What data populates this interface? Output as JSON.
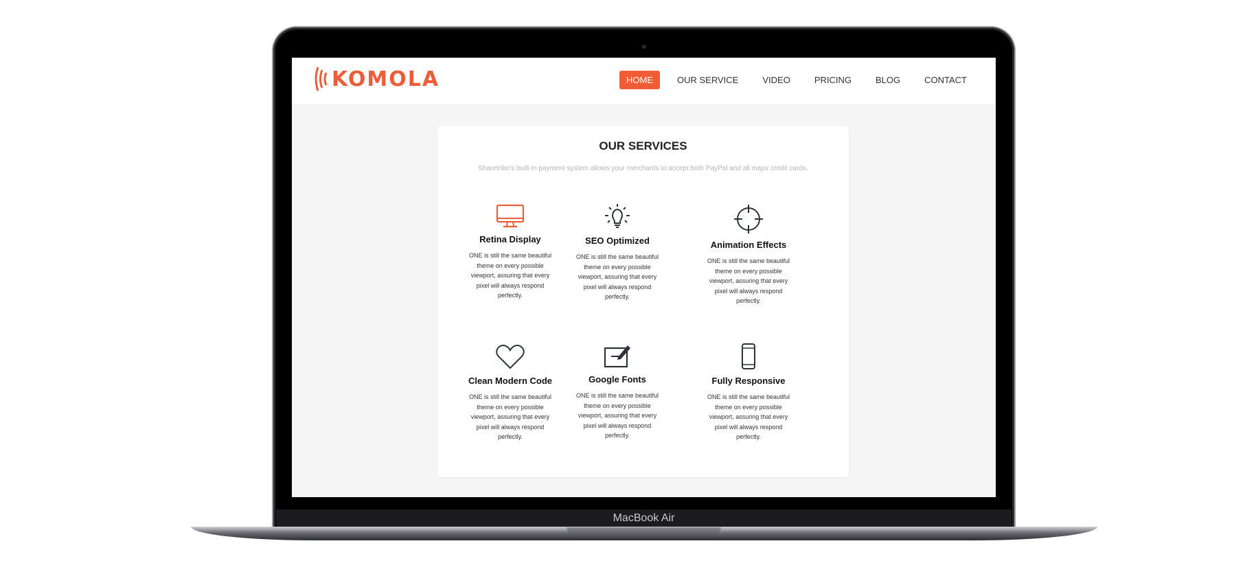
{
  "device": {
    "label": "MacBook Air"
  },
  "header": {
    "logo_text": "KOMOLA",
    "menu": [
      {
        "label": "HOME",
        "active": true
      },
      {
        "label": "OUR SERVICE",
        "active": false
      },
      {
        "label": "VIDEO",
        "active": false
      },
      {
        "label": "PRICING",
        "active": false
      },
      {
        "label": "BLOG",
        "active": false
      },
      {
        "label": "CONTACT",
        "active": false
      }
    ]
  },
  "services": {
    "title": "OUR SERVICES",
    "subtitle": "Sharetribe's built-in payment system allows your merchants to accept both PayPal and all major credit cards.",
    "items": [
      {
        "icon": "monitor-icon",
        "title": "Retina Display",
        "desc": "ONE is still the same beautiful theme on every possible viewport, assuring that every pixel will always respond perfectly."
      },
      {
        "icon": "lightbulb-icon",
        "title": "SEO Optimized",
        "desc": "ONE is still the same beautiful theme on every possible viewport, assuring that every pixel will always respond perfectly."
      },
      {
        "icon": "crosshair-icon",
        "title": "Animation Effects",
        "desc": "ONE is still the same beautiful theme on every possible viewport, assuring that every pixel will always respond perfectly."
      },
      {
        "icon": "heart-icon",
        "title": "Clean Modern Code",
        "desc": "ONE is still the same beautiful theme on every possible viewport, assuring that every pixel will always respond perfectly."
      },
      {
        "icon": "edit-icon",
        "title": "Google Fonts",
        "desc": "ONE is still the same beautiful theme on every possible viewport, assuring that every pixel will always respond perfectly."
      },
      {
        "icon": "smartphone-icon",
        "title": "Fully Responsive",
        "desc": "ONE is still the same beautiful theme on every possible viewport, assuring that every pixel will always respond perfectly."
      }
    ]
  },
  "colors": {
    "accent": "#f25c35",
    "logo": "#ea5f3a",
    "icon_dark": "#2f3238"
  }
}
